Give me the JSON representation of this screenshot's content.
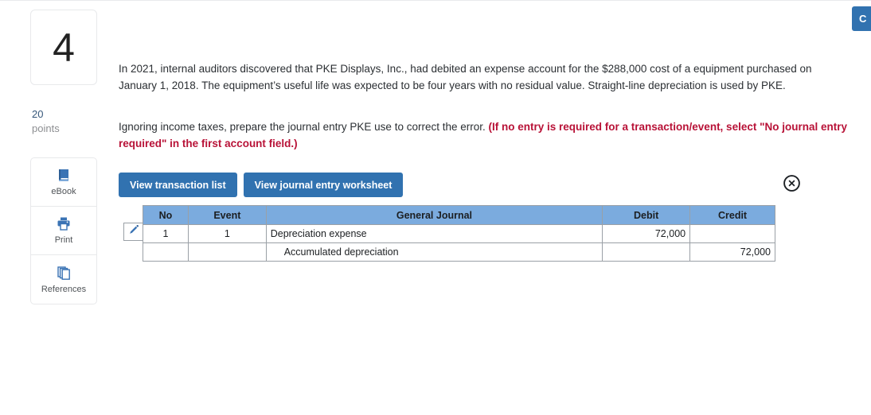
{
  "corner": {
    "label": "C",
    "icon": "partial-blue-button",
    "color": "#3172b0"
  },
  "question": {
    "number": "4",
    "points_value": "20",
    "points_label": "points"
  },
  "tools": [
    {
      "name": "ebook",
      "label": "eBook",
      "icon": "book-icon"
    },
    {
      "name": "print",
      "label": "Print",
      "icon": "printer-icon"
    },
    {
      "name": "references",
      "label": "References",
      "icon": "pages-icon"
    }
  ],
  "prompt": {
    "paragraph1": "In 2021, internal auditors discovered that PKE Displays, Inc., had debited an expense account for the $288,000 cost of a equipment purchased on January 1, 2018. The equipment’s useful life was expected to be four years with no residual value. Straight-line depreciation is used by PKE.",
    "paragraph2_plain": "Ignoring income taxes, prepare the journal entry PKE use to correct the error. ",
    "paragraph2_bold": "(If no entry is required for a transaction/event, select \"No journal entry required\" in the first account field.)",
    "warn_color": "#b81237"
  },
  "tabs": [
    {
      "name": "view-transaction-list",
      "label": "View transaction list"
    },
    {
      "name": "view-journal-entry-worksheet",
      "label": "View journal entry worksheet"
    }
  ],
  "close_icon": "circle-x-icon",
  "table": {
    "headers": [
      "No",
      "Event",
      "General Journal",
      "Debit",
      "Credit"
    ],
    "header_color": "#7babde",
    "edit_icon": "pencil-icon",
    "rows": [
      {
        "no": "1",
        "event": "1",
        "account": "Depreciation expense",
        "debit": "72,000",
        "credit": "",
        "indent": false,
        "editable": true
      },
      {
        "no": "",
        "event": "",
        "account": "Accumulated depreciation",
        "debit": "",
        "credit": "72,000",
        "indent": true,
        "editable": false
      }
    ]
  }
}
